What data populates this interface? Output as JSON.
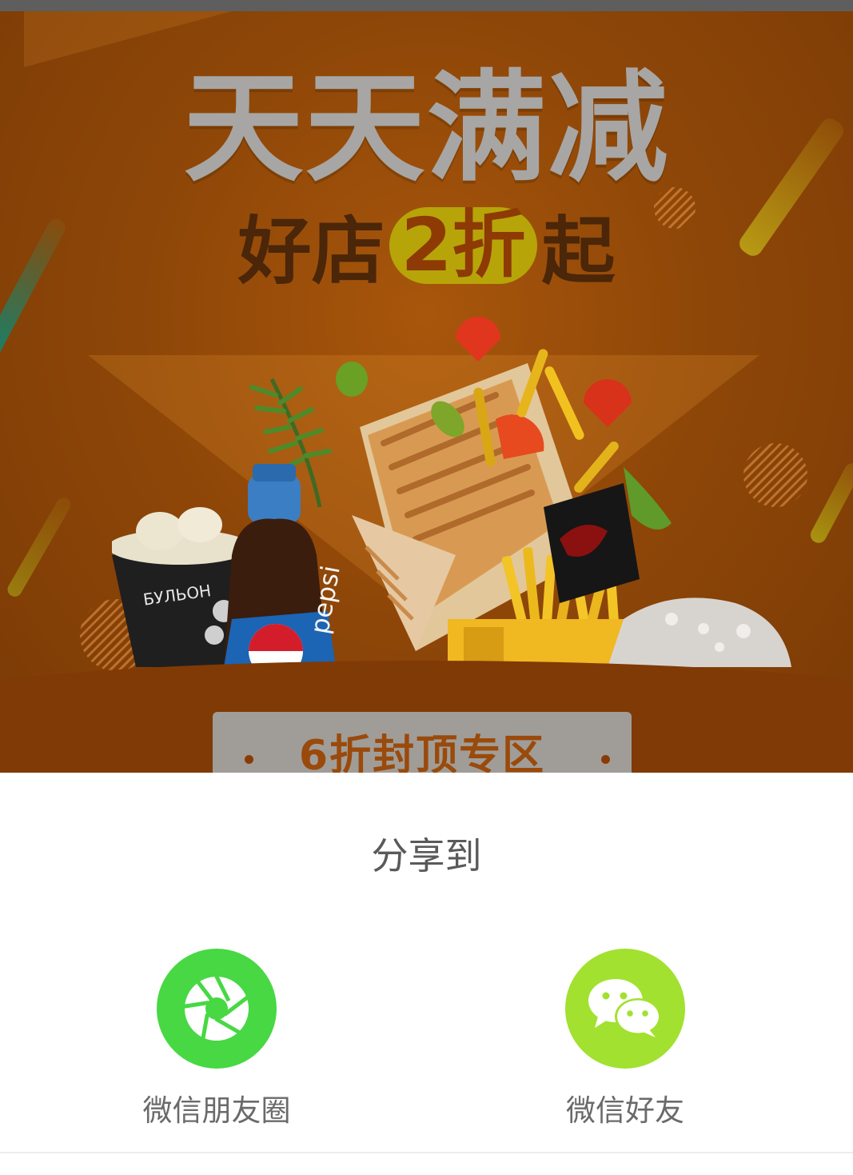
{
  "banner": {
    "headline": "天天满减",
    "subhead_prefix": "好店",
    "subhead_highlight": "2折",
    "subhead_suffix": "起",
    "ribbon_text": "6折封顶专区",
    "cup_brand": "БУЛЬОН",
    "bottle_brand": "pepsi"
  },
  "share": {
    "title": "分享到",
    "options": [
      {
        "label": "微信朋友圈",
        "icon": "camera-shutter-icon",
        "color": "#47d844"
      },
      {
        "label": "微信好友",
        "icon": "wechat-chat-icon",
        "color": "#a2e12f"
      }
    ]
  },
  "colors": {
    "banner_orange": "#8f4708",
    "headline_gray": "#a7a6a4",
    "moments_green": "#47d844",
    "friend_green": "#a2e12f"
  }
}
